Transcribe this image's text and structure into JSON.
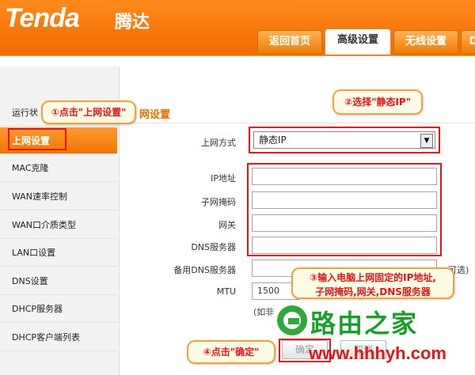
{
  "brand": {
    "logo": "Tenda",
    "logo_cn": "腾达"
  },
  "tabs": [
    "返回首页",
    "高级设置",
    "无线设置",
    "D"
  ],
  "sidebar": {
    "items": [
      "运行状",
      "上网设置",
      "MAC克隆",
      "WAN速率控制",
      "WAN口介质类型",
      "LAN口设置",
      "DNS设置",
      "DHCP服务器",
      "DHCP客户端列表"
    ]
  },
  "section": {
    "title": "网设置"
  },
  "form": {
    "connection_type_label": "上网方式",
    "connection_type_value": "静态IP",
    "ip_label": "IP地址",
    "mask_label": "子网掩码",
    "gateway_label": "网关",
    "dns_label": "DNS服务器",
    "dns2_label": "备用DNS服务器",
    "dns2_suffix": "可选)",
    "mtu_label": "MTU",
    "mtu_value": "1500",
    "mtu_note": "(如非"
  },
  "buttons": {
    "ok": "确定",
    "cancel": "取消"
  },
  "annotations": {
    "step1": "①点击\"上网设置\"",
    "step2": "②选择\"静态IP\"",
    "step3_line1": "③输入电脑上网固定的IP地址,",
    "step3_line2": "子网掩码,网关,DNS服务器",
    "step4": "④点击\"确定\""
  },
  "watermark": {
    "text": "路由之家",
    "url": "www.hhhyh.com"
  },
  "colors": {
    "accent": "#f07a00",
    "annotation_red": "#e01717",
    "watermark_green": "#1aa02a"
  }
}
